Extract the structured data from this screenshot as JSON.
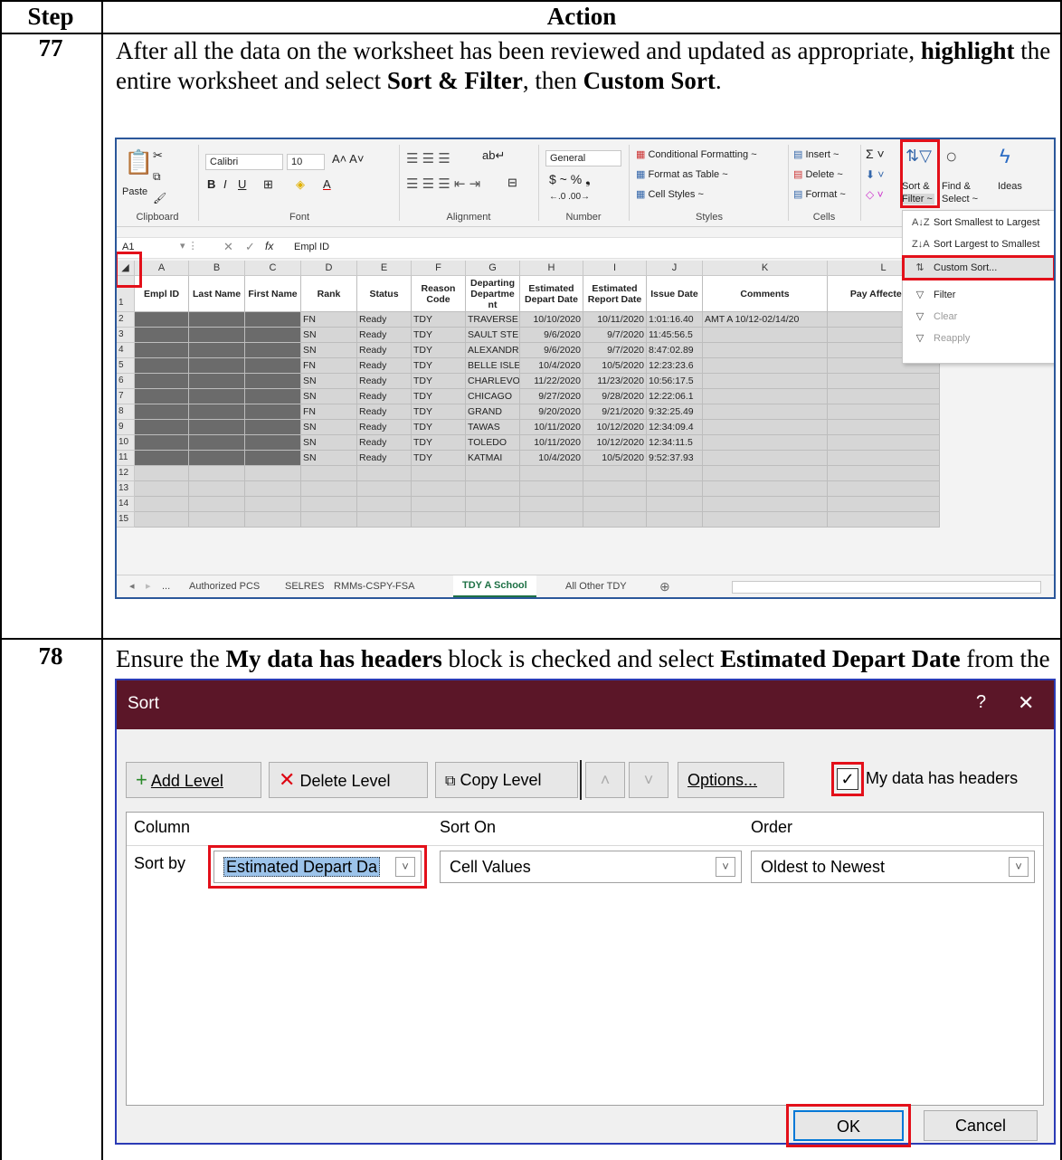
{
  "table": {
    "header_step": "Step",
    "header_action": "Action"
  },
  "step77": {
    "number": "77",
    "text_1": "After all the data on the worksheet has been reviewed and updated as appropriate, ",
    "bold_1": "highlight",
    "text_2": " the entire worksheet and select ",
    "bold_2": "Sort & Filter",
    "text_3": ", then ",
    "bold_3": "Custom Sort",
    "text_4": "."
  },
  "excel": {
    "ribbon": {
      "paste": "Paste",
      "clipboard": "Clipboard",
      "font_name": "Calibri",
      "font_size": "10",
      "font_group": "Font",
      "alignment_group": "Alignment",
      "number_format": "General",
      "number_group": "Number",
      "cond_format": "Conditional Formatting ~",
      "format_table": "Format as Table ~",
      "cell_styles": "Cell Styles ~",
      "styles_group": "Styles",
      "insert": "Insert ~",
      "delete": "Delete ~",
      "format": "Format ~",
      "cells_group": "Cells",
      "sort_filter_1": "Sort &",
      "sort_filter_2": "Filter ~",
      "find_select_1": "Find &",
      "find_select_2": "Select ~",
      "ideas": "Ideas"
    },
    "name_box": "A1",
    "formula": "Empl ID",
    "columns": [
      "A",
      "B",
      "C",
      "D",
      "E",
      "F",
      "G",
      "H",
      "I",
      "J",
      "K",
      "L"
    ],
    "headers": [
      "Empl ID",
      "Last Name",
      "First Name",
      "Rank",
      "Status",
      "Reason Code",
      "Departing Departme nt",
      "Estimated Depart Date",
      "Estimated Report Date",
      "Issue Date",
      "Comments",
      "Pay Affected S"
    ],
    "rows": [
      [
        "",
        "",
        "",
        "FN",
        "Ready",
        "TDY",
        "TRAVERSE",
        "10/10/2020",
        "10/11/2020",
        "1:01:16.40",
        "AMT A 10/12-02/14/20",
        ""
      ],
      [
        "",
        "",
        "",
        "SN",
        "Ready",
        "TDY",
        "SAULT STE",
        "9/6/2020",
        "9/7/2020",
        "11:45:56.5",
        "",
        ""
      ],
      [
        "",
        "",
        "",
        "SN",
        "Ready",
        "TDY",
        "ALEXANDRI",
        "9/6/2020",
        "9/7/2020",
        "8:47:02.89",
        "",
        ""
      ],
      [
        "",
        "",
        "",
        "FN",
        "Ready",
        "TDY",
        "BELLE ISLE",
        "10/4/2020",
        "10/5/2020",
        "12:23:23.6",
        "",
        ""
      ],
      [
        "",
        "",
        "",
        "SN",
        "Ready",
        "TDY",
        "CHARLEVO",
        "11/22/2020",
        "11/23/2020",
        "10:56:17.5",
        "",
        ""
      ],
      [
        "",
        "",
        "",
        "SN",
        "Ready",
        "TDY",
        "CHICAGO",
        "9/27/2020",
        "9/28/2020",
        "12:22:06.1",
        "",
        ""
      ],
      [
        "",
        "",
        "",
        "FN",
        "Ready",
        "TDY",
        "GRAND",
        "9/20/2020",
        "9/21/2020",
        "9:32:25.49",
        "",
        ""
      ],
      [
        "",
        "",
        "",
        "SN",
        "Ready",
        "TDY",
        "TAWAS",
        "10/11/2020",
        "10/12/2020",
        "12:34:09.4",
        "",
        ""
      ],
      [
        "",
        "",
        "",
        "SN",
        "Ready",
        "TDY",
        "TOLEDO",
        "10/11/2020",
        "10/12/2020",
        "12:34:11.5",
        "",
        ""
      ],
      [
        "",
        "",
        "",
        "SN",
        "Ready",
        "TDY",
        "KATMAI",
        "10/4/2020",
        "10/5/2020",
        "9:52:37.93",
        "",
        ""
      ]
    ],
    "row_numbers": [
      "1",
      "2",
      "3",
      "4",
      "5",
      "6",
      "7",
      "8",
      "9",
      "10",
      "11",
      "12",
      "13",
      "14",
      "15"
    ],
    "sheet_tabs": [
      "...",
      "Authorized PCS",
      "SELRES",
      "RMMs-CSPY-FSA",
      "TDY A School",
      "All Other TDY"
    ],
    "active_tab": "TDY A School",
    "menu": [
      "Sort Smallest to Largest",
      "Sort Largest to Smallest",
      "Custom Sort...",
      "Filter",
      "Clear",
      "Reapply"
    ]
  },
  "step78": {
    "number": "78",
    "text_1": "Ensure the ",
    "bold_1": "My data has headers",
    "text_2": " block is checked and select ",
    "bold_2": "Estimated Depart Date",
    "text_3": " from the Sort by drop-down.  Click ",
    "bold_3": "OK",
    "text_4": "."
  },
  "dialog": {
    "title": "Sort",
    "help": "?",
    "close": "✕",
    "add_level": "Add Level",
    "delete_level": "Delete Level",
    "copy_level": "Copy Level",
    "options": "Options...",
    "headers_label": "My data has headers",
    "col_column": "Column",
    "col_sort_on": "Sort On",
    "col_order": "Order",
    "sort_by": "Sort by",
    "column_value": "Estimated Depart Da",
    "sort_on_value": "Cell Values",
    "order_value": "Oldest to Newest",
    "ok": "OK",
    "cancel": "Cancel"
  },
  "colors": {
    "highlight_red": "#e3101a",
    "dialog_title": "#5b1628",
    "excel_blue": "#2b579a"
  }
}
